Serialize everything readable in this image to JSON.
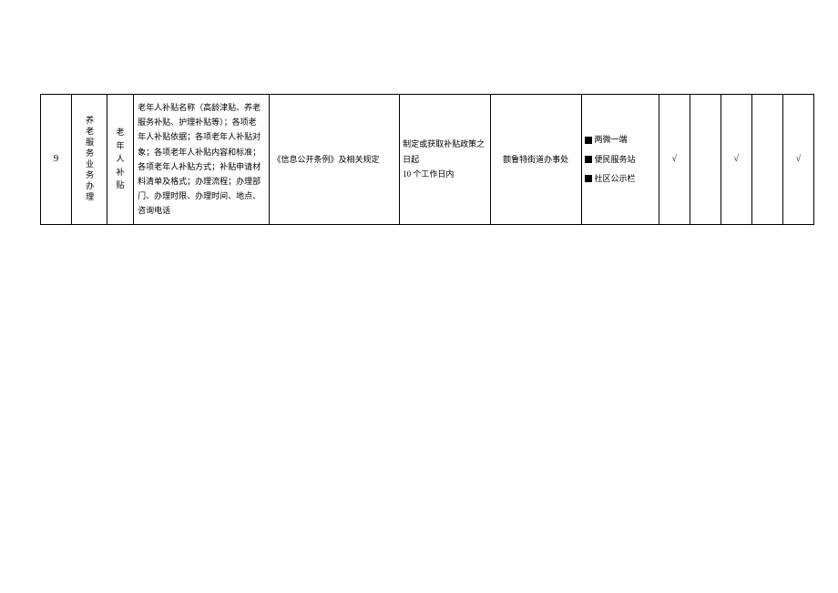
{
  "row": {
    "num": "9",
    "category1": "养老服务业务办理",
    "category2": "老年人补贴",
    "content": "老年人补贴名称（高龄津贴、养老服务补贴、护理补贴等）；各项老年人补贴依据；各项老年人补贴对象；各项老年人补贴内容和标准；各项老年人补贴方式；补贴申请材料清单及格式；办理流程；办理部门、办理时限、办理时间、地点、咨询电话",
    "basis": "《信息公开条例》及相关规定",
    "timelimit": "制定或获取补贴政策之日起",
    "timelimit2": "10 个工作日内",
    "subject": "额鲁特街道办事处",
    "channels": {
      "c1": "两微一端",
      "c2": "便民服务站",
      "c3": "社区公示栏"
    },
    "checks": {
      "k1": "√",
      "k2": "",
      "k3": "√",
      "k4": "",
      "k5": "√"
    }
  }
}
